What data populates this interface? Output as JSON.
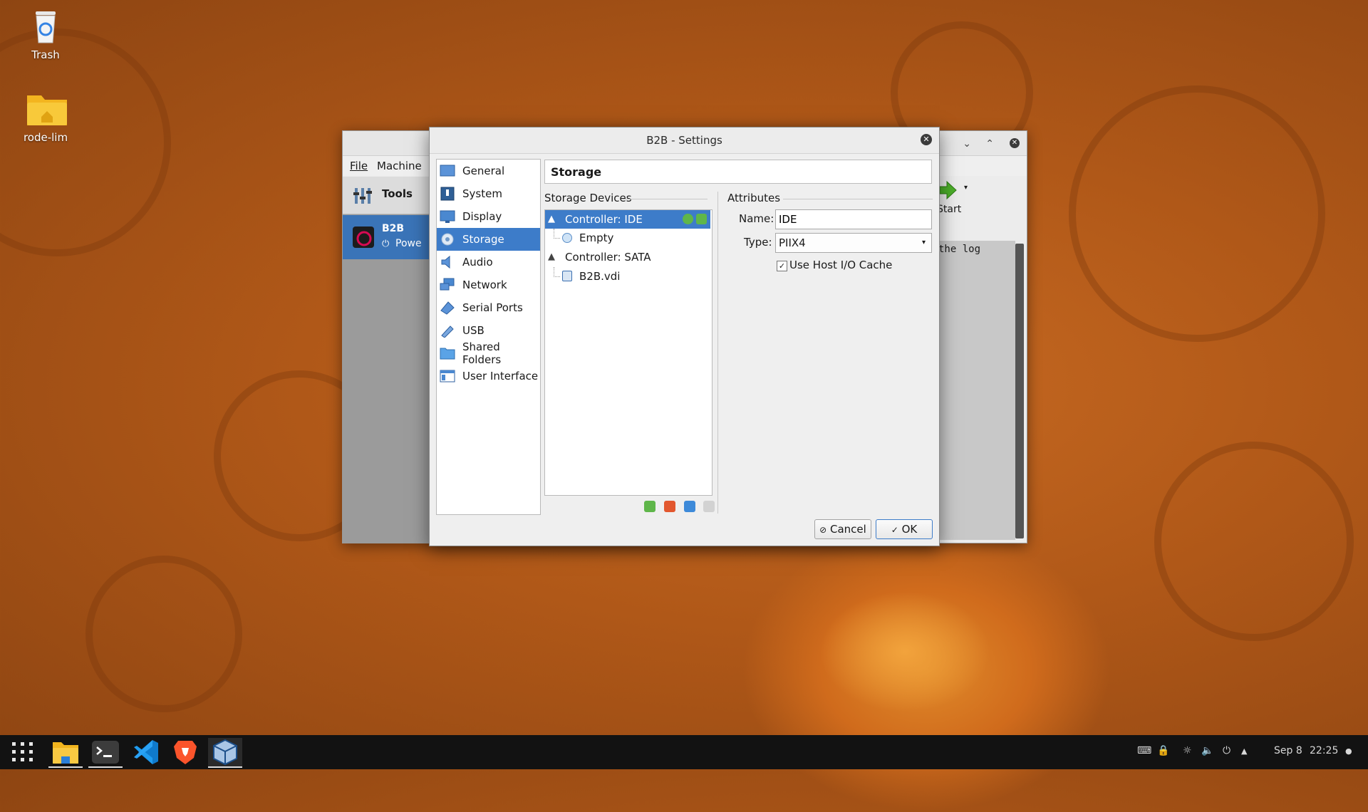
{
  "desktop": {
    "icons": [
      {
        "label": "Trash"
      },
      {
        "label": "rode-lim"
      }
    ]
  },
  "manager": {
    "menu": {
      "file": "File",
      "machine": "Machine"
    },
    "tools_label": "Tools",
    "vm": {
      "name": "B2B",
      "state": "Powe"
    },
    "start_label": "Start",
    "log_text": "the log"
  },
  "dialog": {
    "title": "B2B - Settings",
    "categories": [
      {
        "label": "General",
        "icon": "general-icon"
      },
      {
        "label": "System",
        "icon": "system-icon"
      },
      {
        "label": "Display",
        "icon": "display-icon"
      },
      {
        "label": "Storage",
        "icon": "storage-icon",
        "selected": true
      },
      {
        "label": "Audio",
        "icon": "audio-icon"
      },
      {
        "label": "Network",
        "icon": "network-icon"
      },
      {
        "label": "Serial Ports",
        "icon": "serial-ports-icon"
      },
      {
        "label": "USB",
        "icon": "usb-icon"
      },
      {
        "label": "Shared Folders",
        "icon": "shared-folders-icon"
      },
      {
        "label": "User Interface",
        "icon": "user-interface-icon"
      }
    ],
    "page_title": "Storage",
    "storage_devices_label": "Storage Devices",
    "tree": {
      "controller_ide": "Controller: IDE",
      "ide_child": "Empty",
      "controller_sata": "Controller: SATA",
      "sata_child": "B2B.vdi"
    },
    "attributes": {
      "section_label": "Attributes",
      "name_label": "Name:",
      "name_value": "IDE",
      "type_label": "Type:",
      "type_value": "PIIX4",
      "host_cache_label": "Use Host I/O Cache",
      "host_cache_checked": true
    },
    "buttons": {
      "cancel": "Cancel",
      "ok": "OK"
    }
  },
  "taskbar": {
    "apps": [
      "apps-grid-icon",
      "files-icon",
      "terminal-icon",
      "vscode-icon",
      "brave-icon",
      "virtualbox-icon"
    ],
    "date": "Sep 8",
    "time": "22:25"
  },
  "colors": {
    "accent": "#3d7cc9",
    "taskbar": "#121212"
  }
}
